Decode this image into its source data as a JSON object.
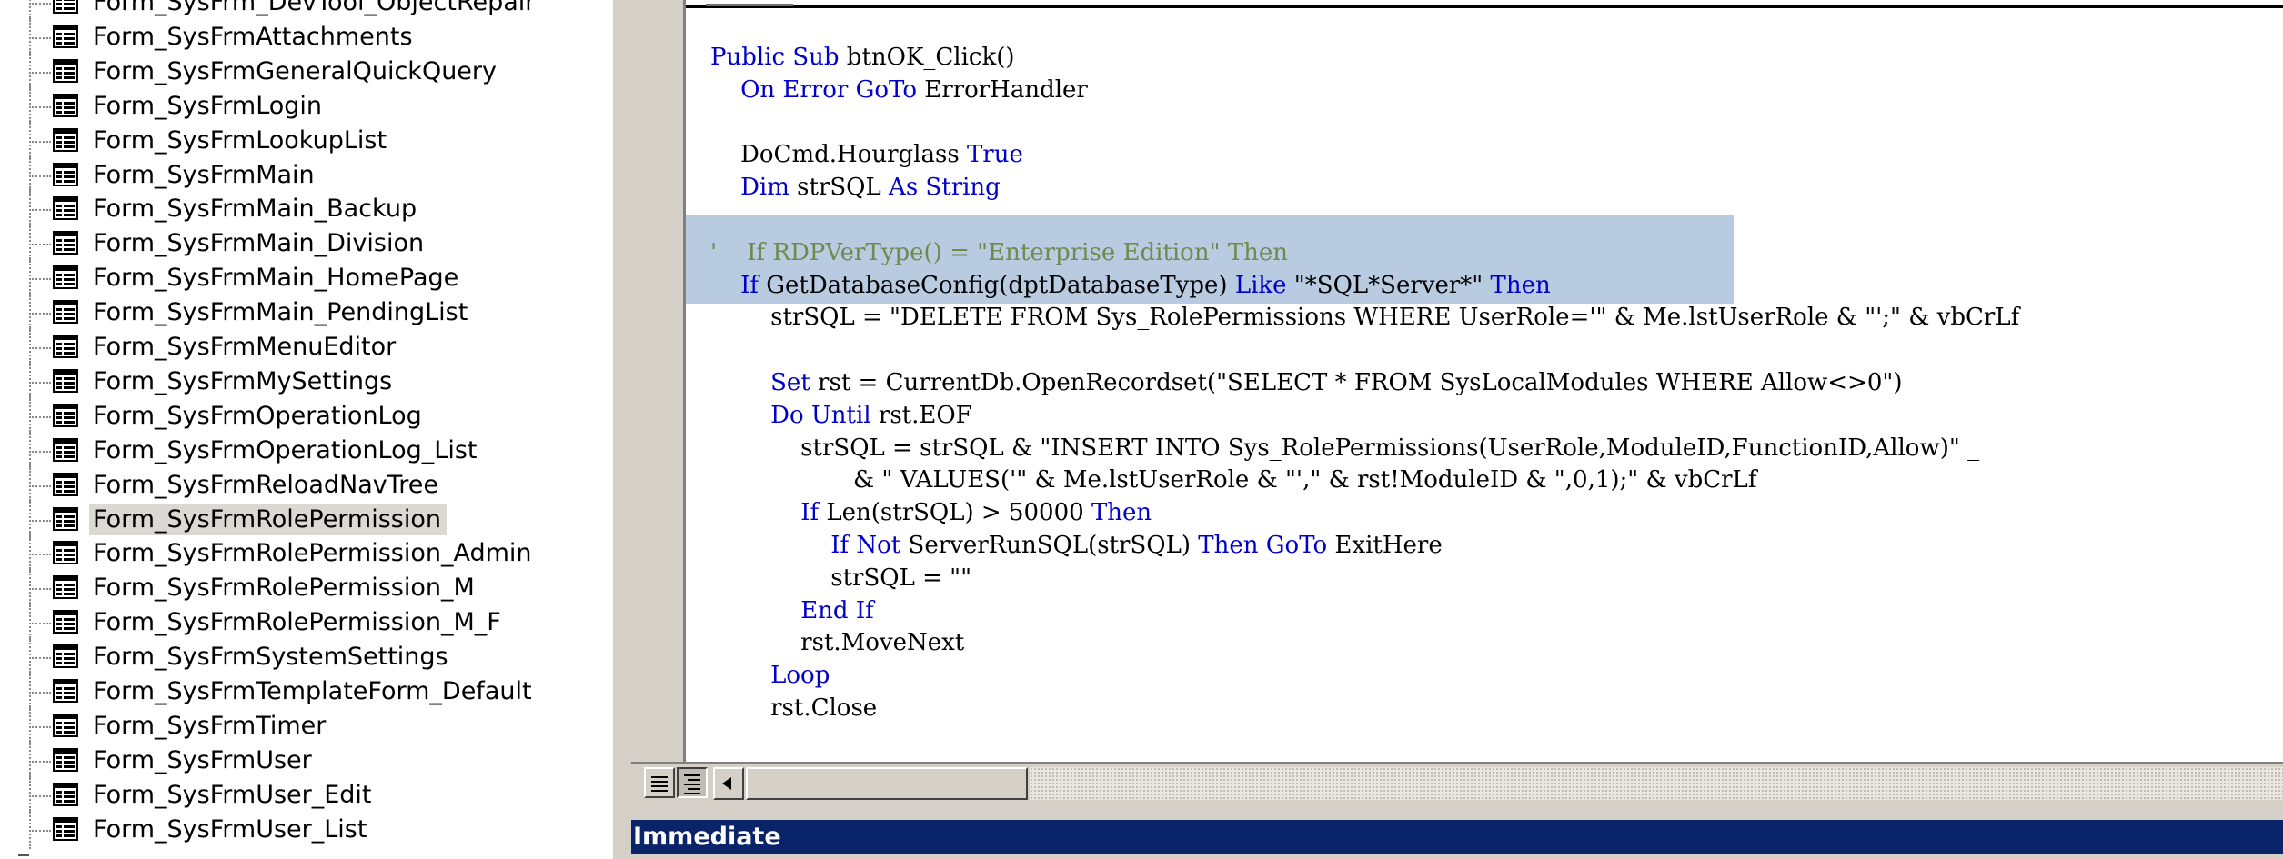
{
  "project_tree": {
    "items": [
      {
        "label": "Form_SysFrm_DevTool_ObjectRepair",
        "selected": false
      },
      {
        "label": "Form_SysFrmAttachments",
        "selected": false
      },
      {
        "label": "Form_SysFrmGeneralQuickQuery",
        "selected": false
      },
      {
        "label": "Form_SysFrmLogin",
        "selected": false
      },
      {
        "label": "Form_SysFrmLookupList",
        "selected": false
      },
      {
        "label": "Form_SysFrmMain",
        "selected": false
      },
      {
        "label": "Form_SysFrmMain_Backup",
        "selected": false
      },
      {
        "label": "Form_SysFrmMain_Division",
        "selected": false
      },
      {
        "label": "Form_SysFrmMain_HomePage",
        "selected": false
      },
      {
        "label": "Form_SysFrmMain_PendingList",
        "selected": false
      },
      {
        "label": "Form_SysFrmMenuEditor",
        "selected": false
      },
      {
        "label": "Form_SysFrmMySettings",
        "selected": false
      },
      {
        "label": "Form_SysFrmOperationLog",
        "selected": false
      },
      {
        "label": "Form_SysFrmOperationLog_List",
        "selected": false
      },
      {
        "label": "Form_SysFrmReloadNavTree",
        "selected": false
      },
      {
        "label": "Form_SysFrmRolePermission",
        "selected": true
      },
      {
        "label": "Form_SysFrmRolePermission_Admin",
        "selected": false
      },
      {
        "label": "Form_SysFrmRolePermission_M",
        "selected": false
      },
      {
        "label": "Form_SysFrmRolePermission_M_F",
        "selected": false
      },
      {
        "label": "Form_SysFrmSystemSettings",
        "selected": false
      },
      {
        "label": "Form_SysFrmTemplateForm_Default",
        "selected": false
      },
      {
        "label": "Form_SysFrmTimer",
        "selected": false
      },
      {
        "label": "Form_SysFrmUser",
        "selected": false
      },
      {
        "label": "Form_SysFrmUser_Edit",
        "selected": false
      },
      {
        "label": "Form_SysFrmUser_List",
        "selected": false
      }
    ],
    "icon": "form-module-icon"
  },
  "code_editor": {
    "colors": {
      "keyword": "#0000c8",
      "comment": "#6f8a4f",
      "text": "#000000",
      "selection": "#b9cbe1"
    },
    "highlighted_lines": [
      5,
      6
    ],
    "lines": [
      [
        {
          "t": "Public Sub",
          "k": "kw"
        },
        {
          "t": " btnOK_Click()"
        }
      ],
      [
        {
          "t": "    "
        },
        {
          "t": "On Error GoTo",
          "k": "kw"
        },
        {
          "t": " ErrorHandler"
        }
      ],
      [],
      [
        {
          "t": "    DoCmd.Hourglass "
        },
        {
          "t": "True",
          "k": "kw"
        }
      ],
      [
        {
          "t": "    "
        },
        {
          "t": "Dim",
          "k": "kw"
        },
        {
          "t": " strSQL "
        },
        {
          "t": "As String",
          "k": "kw"
        }
      ],
      [],
      [
        {
          "t": "'    If RDPVerType() = \"Enterprise Edition\" Then",
          "k": "cm"
        }
      ],
      [
        {
          "t": "    "
        },
        {
          "t": "If",
          "k": "kw"
        },
        {
          "t": " GetDatabaseConfig(dptDatabaseType) "
        },
        {
          "t": "Like",
          "k": "kw"
        },
        {
          "t": " \"*SQL*Server*\" "
        },
        {
          "t": "Then",
          "k": "kw"
        }
      ],
      [
        {
          "t": "        strSQL = \"DELETE FROM Sys_RolePermissions WHERE UserRole='\" & Me.lstUserRole & \"';\" & vbCrLf"
        }
      ],
      [],
      [
        {
          "t": "        "
        },
        {
          "t": "Set",
          "k": "kw"
        },
        {
          "t": " rst = CurrentDb.OpenRecordset(\"SELECT * FROM SysLocalModules WHERE Allow<>0\")"
        }
      ],
      [
        {
          "t": "        "
        },
        {
          "t": "Do Until",
          "k": "kw"
        },
        {
          "t": " rst.EOF"
        }
      ],
      [
        {
          "t": "            strSQL = strSQL & \"INSERT INTO Sys_RolePermissions(UserRole,ModuleID,FunctionID,Allow)\" _"
        }
      ],
      [
        {
          "t": "                   & \" VALUES('\" & Me.lstUserRole & \"',\" & rst!ModuleID & \",0,1);\" & vbCrLf"
        }
      ],
      [
        {
          "t": "            "
        },
        {
          "t": "If",
          "k": "kw"
        },
        {
          "t": " Len(strSQL) > 50000 "
        },
        {
          "t": "Then",
          "k": "kw"
        }
      ],
      [
        {
          "t": "                "
        },
        {
          "t": "If Not",
          "k": "kw"
        },
        {
          "t": " ServerRunSQL(strSQL) "
        },
        {
          "t": "Then GoTo",
          "k": "kw"
        },
        {
          "t": " ExitHere"
        }
      ],
      [
        {
          "t": "                strSQL = \"\""
        }
      ],
      [
        {
          "t": "            "
        },
        {
          "t": "End If",
          "k": "kw"
        }
      ],
      [
        {
          "t": "            rst.MoveNext"
        }
      ],
      [
        {
          "t": "        "
        },
        {
          "t": "Loop",
          "k": "kw"
        }
      ],
      [
        {
          "t": "        rst.Close"
        }
      ]
    ]
  },
  "bottom_bar": {
    "procedure_view_icon": "procedure-view-icon",
    "full_module_view_icon": "full-module-view-icon",
    "scroll_left_icon": "arrow-left-icon"
  },
  "immediate_window": {
    "title": "Immediate",
    "title_bg": "#0a246a"
  }
}
